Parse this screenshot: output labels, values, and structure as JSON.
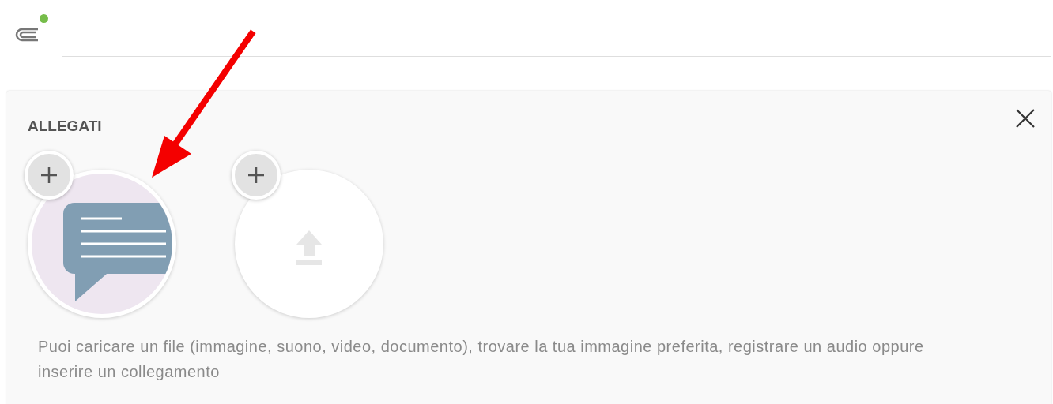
{
  "attachment_indicator": {
    "active": true
  },
  "panel": {
    "title": "ALLEGATI",
    "tiles": [
      {
        "kind": "message"
      },
      {
        "kind": "upload"
      }
    ],
    "hint": "Puoi caricare un file (immagine, suono, video, documento), trovare la tua immagine preferita, registrare un audio oppure inserire un collegamento"
  }
}
